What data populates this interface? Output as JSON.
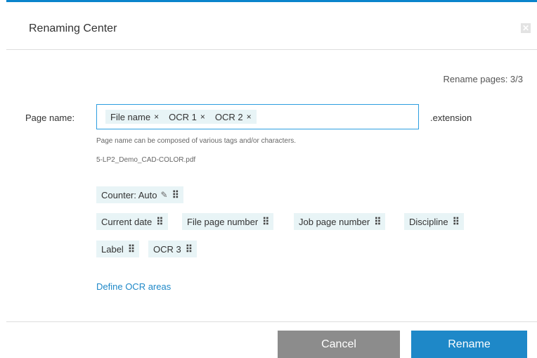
{
  "dialog": {
    "title": "Renaming Center",
    "close_icon": "close-icon",
    "close_glyph": "✕",
    "rename_count": "Rename pages: 3/3"
  },
  "form": {
    "page_name_label": "Page name:",
    "input_tags": [
      {
        "label": "File name",
        "remove": "×"
      },
      {
        "label": "OCR 1",
        "remove": "×"
      },
      {
        "label": "OCR 2",
        "remove": "×"
      }
    ],
    "extension": ".extension",
    "help_text": "Page name can be composed of various tags and/or characters.",
    "preview_filename": "5-LP2_Demo_CAD-COLOR.pdf"
  },
  "available_tags": [
    {
      "label": "Counter: Auto",
      "editable": true
    },
    {
      "label": "Current date"
    },
    {
      "label": "File page number"
    },
    {
      "label": "Job page number"
    },
    {
      "label": "Discipline"
    },
    {
      "label": "Label"
    },
    {
      "label": "OCR 3"
    }
  ],
  "glyphs": {
    "handle": "⠿",
    "pencil": "✎"
  },
  "links": {
    "define_ocr": "Define OCR areas"
  },
  "buttons": {
    "cancel": "Cancel",
    "rename": "Rename"
  },
  "colors": {
    "accent": "#1e88c8",
    "tag_bg": "#e8f4f6",
    "cancel_bg": "#8c8c8c",
    "input_border": "#2d9ee0"
  }
}
